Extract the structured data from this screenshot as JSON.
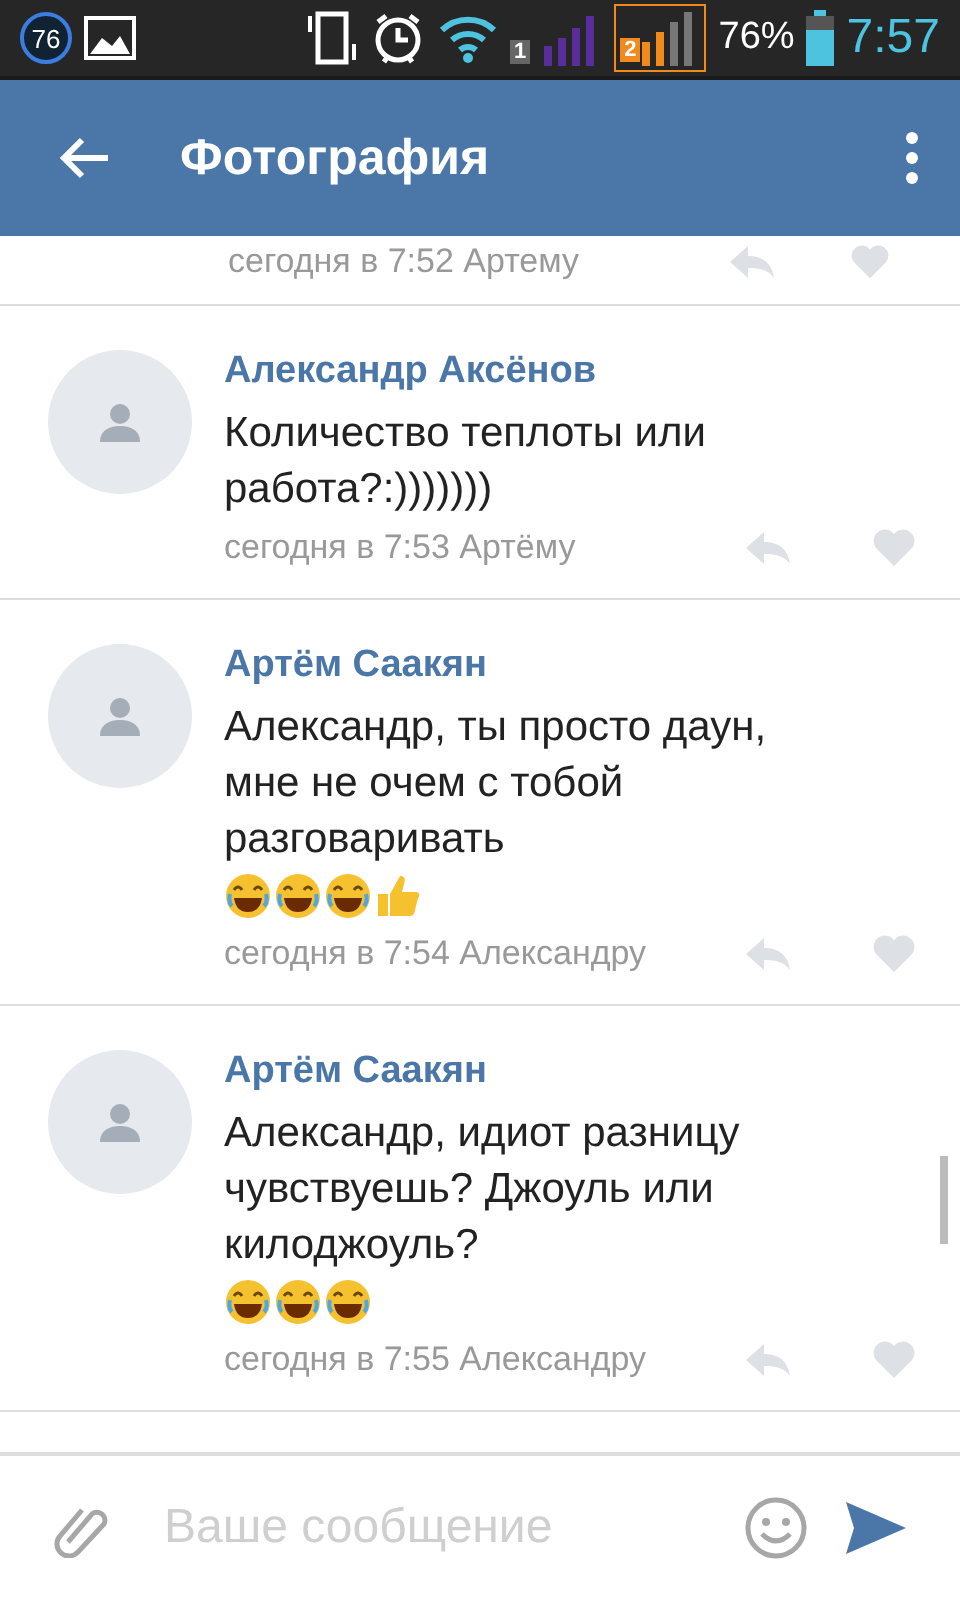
{
  "status_bar": {
    "notification_badge": "76",
    "sim_1": "1",
    "sim_2": "2",
    "battery": "76%",
    "time": "7:57"
  },
  "header": {
    "title": "Фотография"
  },
  "partial_comment": {
    "meta": "сегодня в 7:52 Артему"
  },
  "comments": [
    {
      "author": "Александр Аксёнов",
      "text": "Количество теплоты или работа?:)))))))",
      "meta": "сегодня в 7:53 Артёму",
      "liked": false
    },
    {
      "author": "Артём Саакян",
      "text": "Александр, ты просто даун, мне не очем с тобой разговаривать",
      "emoji": [
        {
          "kind": "laugh"
        },
        {
          "kind": "laugh"
        },
        {
          "kind": "laugh"
        },
        {
          "kind": "thumbs_up"
        }
      ],
      "meta": "сегодня в 7:54 Александру",
      "liked": false
    },
    {
      "author": "Артём Саакян",
      "text": "Александр, идиот разницу чувствуешь? Джоуль или килоджоуль?",
      "emoji": [
        {
          "kind": "laugh"
        },
        {
          "kind": "laugh"
        },
        {
          "kind": "laugh"
        }
      ],
      "meta": "сегодня в 7:55 Александру",
      "liked": false
    }
  ],
  "composer": {
    "placeholder": "Ваше сообщение"
  }
}
